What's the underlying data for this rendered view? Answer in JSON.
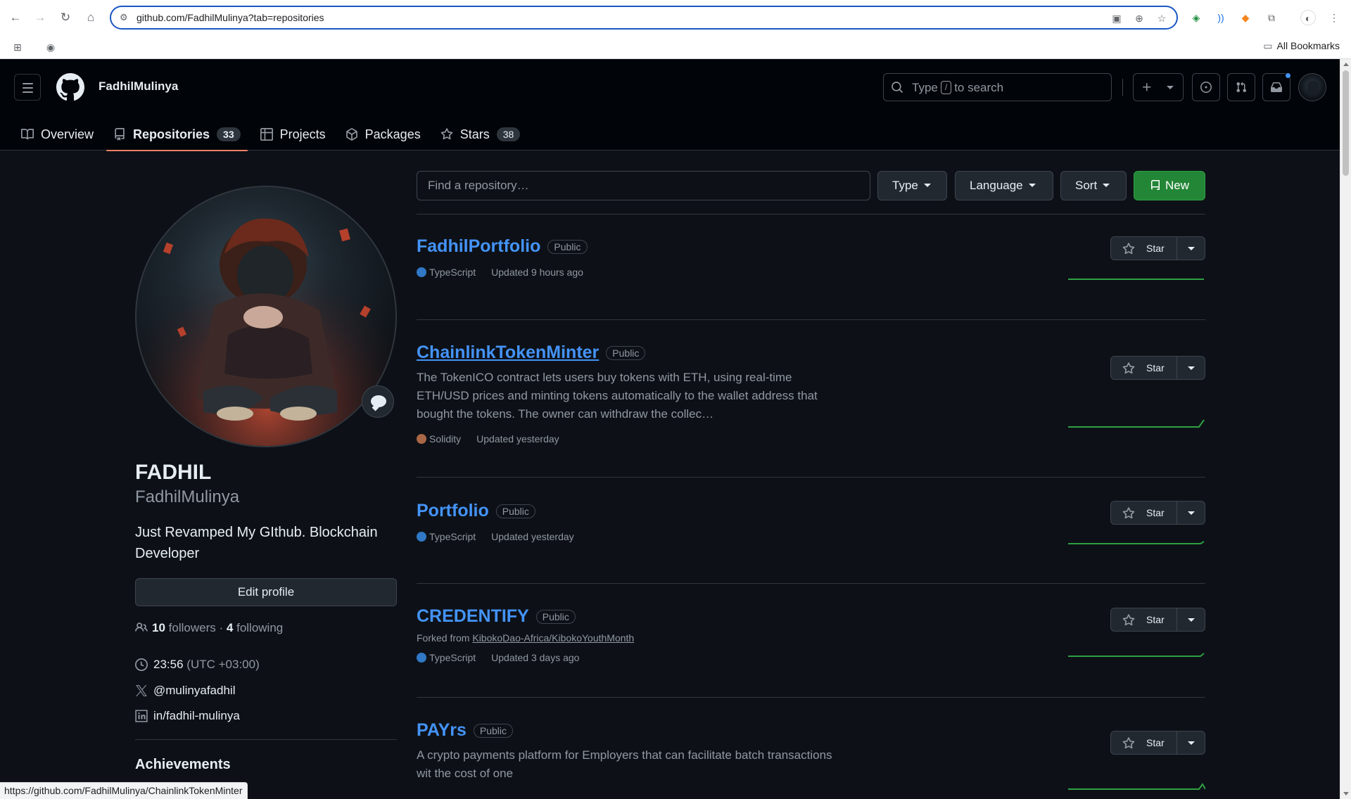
{
  "browser": {
    "url": "github.com/FadhilMulinya?tab=repositories",
    "all_bookmarks": "All Bookmarks",
    "status_url": "https://github.com/FadhilMulinya/ChainlinkTokenMinter"
  },
  "header": {
    "username": "FadhilMulinya",
    "search_prefix": "Type",
    "search_slash": "/",
    "search_suffix": "to search"
  },
  "tabs": [
    {
      "label": "Overview",
      "icon": "book-icon"
    },
    {
      "label": "Repositories",
      "icon": "repo-icon",
      "count": "33",
      "active": true
    },
    {
      "label": "Projects",
      "icon": "table-icon"
    },
    {
      "label": "Packages",
      "icon": "package-icon"
    },
    {
      "label": "Stars",
      "icon": "star-icon",
      "count": "38"
    }
  ],
  "profile": {
    "name": "FADHIL",
    "login": "FadhilMulinya",
    "bio": "Just Revamped My GIthub. Blockchain Developer",
    "edit_label": "Edit profile",
    "followers_count": "10",
    "followers_label": "followers",
    "separator": "·",
    "following_count": "4",
    "following_label": "following",
    "time": "23:56",
    "timezone": "(UTC +03:00)",
    "twitter": "@mulinyafadhil",
    "linkedin": "in/fadhil-mulinya",
    "achievements": "Achievements"
  },
  "filters": {
    "search_placeholder": "Find a repository…",
    "type_label": "Type",
    "language_label": "Language",
    "sort_label": "Sort",
    "new_label": "New"
  },
  "colors": {
    "typescript": "#3178c6",
    "solidity": "#aa6746",
    "link": "#4493f8",
    "new_button": "#238636",
    "tab_underline": "#f78166"
  },
  "repos": [
    {
      "name": "FadhilPortfolio",
      "visibility": "Public",
      "language": "TypeScript",
      "updated": "Updated 9 hours ago"
    },
    {
      "name": "ChainlinkTokenMinter",
      "visibility": "Public",
      "description": "The TokenICO contract lets users buy tokens with ETH, using real-time ETH/USD prices and minting tokens automatically to the wallet address that bought the tokens. The owner can withdraw the collec…",
      "language": "Solidity",
      "updated": "Updated yesterday"
    },
    {
      "name": "Portfolio",
      "visibility": "Public",
      "language": "TypeScript",
      "updated": "Updated yesterday"
    },
    {
      "name": "CREDENTIFY",
      "visibility": "Public",
      "fork_prefix": "Forked from",
      "fork_source": "KibokoDao-Africa/KibokoYouthMonth",
      "language": "TypeScript",
      "updated": "Updated 3 days ago"
    },
    {
      "name": "PAYrs",
      "visibility": "Public",
      "description": "A crypto payments platform for Employers that can facilitate batch transactions wit the cost of one"
    }
  ],
  "star_label": "Star"
}
